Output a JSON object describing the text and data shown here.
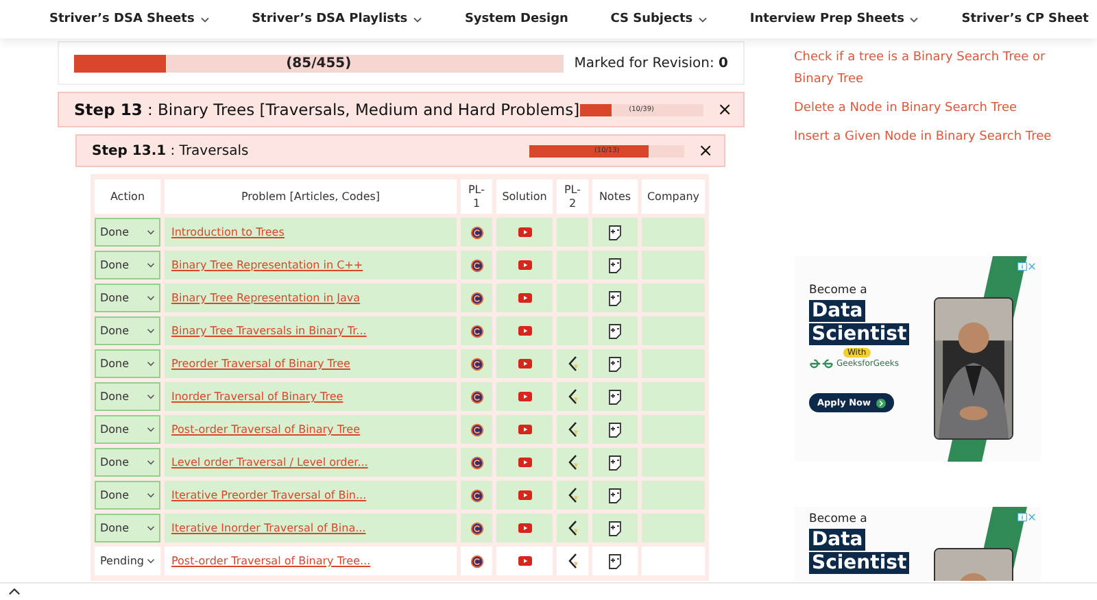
{
  "nav": [
    {
      "label": "Striver’s DSA Sheets",
      "dropdown": true
    },
    {
      "label": "Striver’s DSA Playlists",
      "dropdown": true
    },
    {
      "label": "System Design",
      "dropdown": false
    },
    {
      "label": "CS Subjects",
      "dropdown": true
    },
    {
      "label": "Interview Prep Sheets",
      "dropdown": true
    },
    {
      "label": "Striver’s CP Sheet",
      "dropdown": false
    }
  ],
  "overall": {
    "count": "(85/455)",
    "level": 0.187,
    "revision": "Marked for Revision: **0**"
  },
  "step": {
    "number": "Step 13",
    "title": " : Binary Trees [Traversals, Medium and Hard Problems]",
    "count": "(10/39)",
    "level": 0.256,
    "close": "×"
  },
  "substep": {
    "number": "Step 13.1",
    "title": " : Traversals",
    "count": "(10/13)",
    "level": 0.77,
    "close": "×"
  },
  "table": {
    "columns": [
      {
        "lines": [
          "Action"
        ]
      },
      {
        "lines": [
          "Problem [Articles, Codes]"
        ]
      },
      {
        "lines": [
          "PL-",
          "1"
        ]
      },
      {
        "lines": [
          "Solution"
        ]
      },
      {
        "lines": [
          "PL-",
          "2"
        ]
      },
      {
        "lines": [
          "Notes"
        ]
      },
      {
        "lines": [
          "Company"
        ]
      }
    ],
    "rows": [
      {
        "status": "Done",
        "completed": true,
        "problem": "Introduction to Trees",
        "pl2": false
      },
      {
        "status": "Done",
        "completed": true,
        "problem": "Binary Tree Representation in C++",
        "pl2": false
      },
      {
        "status": "Done",
        "completed": true,
        "problem": "Binary Tree Representation in Java",
        "pl2": false
      },
      {
        "status": "Done",
        "completed": true,
        "problem": "Binary Tree Traversals in Binary Tr...",
        "pl2": false
      },
      {
        "status": "Done",
        "completed": true,
        "problem": "Preorder Traversal of Binary Tree",
        "pl2": true
      },
      {
        "status": "Done",
        "completed": true,
        "problem": "Inorder Traversal of Binary Tree",
        "pl2": true
      },
      {
        "status": "Done",
        "completed": true,
        "problem": "Post-order Traversal of Binary Tree",
        "pl2": true
      },
      {
        "status": "Done",
        "completed": true,
        "problem": "Level order Traversal / Level order...",
        "pl2": true
      },
      {
        "status": "Done",
        "completed": true,
        "problem": "Iterative Preorder Traversal of Bin...",
        "pl2": true
      },
      {
        "status": "Done",
        "completed": true,
        "problem": "Iterative Inorder Traversal of Bina...",
        "pl2": true
      },
      {
        "status": "Pending",
        "completed": false,
        "problem": "Post-order Traversal of Binary Tree...",
        "pl2": true
      }
    ]
  },
  "sidebar_links": [
    "Check if a tree is a Binary Search Tree or Binary Tree",
    "Delete a Node in Binary Search Tree",
    "Insert a Given Node in Binary Search Tree"
  ],
  "ads": [
    {
      "kicker": "Become a",
      "headline": [
        "Data",
        "Scientist"
      ],
      "badge": "With",
      "brand": "GeeksforGeeks",
      "cta": "Apply Now"
    },
    {
      "kicker": "Become a",
      "headline": [
        "Data",
        "Scientist"
      ]
    }
  ]
}
